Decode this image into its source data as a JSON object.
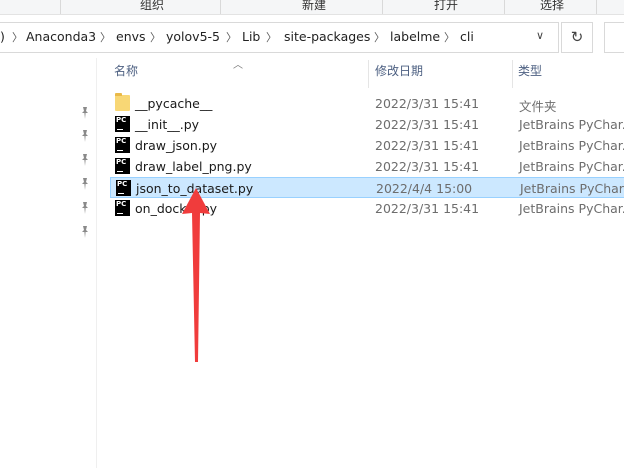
{
  "ribbon": {
    "labels": [
      "组织",
      "新建",
      "打开",
      "选择"
    ]
  },
  "address": {
    "crumbs": [
      "Anaconda3",
      "envs",
      "yolov5-5",
      "Lib",
      "site-packages",
      "labelme",
      "cli"
    ],
    "leading": ")"
  },
  "columns": {
    "name": "名称",
    "date": "修改日期",
    "type": "类型"
  },
  "files": [
    {
      "name": "__pycache__",
      "date": "2022/3/31 15:41",
      "type": "文件夹",
      "icon": "folder-icon"
    },
    {
      "name": "__init__.py",
      "date": "2022/3/31 15:41",
      "type": "JetBrains PyChar...",
      "icon": "pycharm-file-icon"
    },
    {
      "name": "draw_json.py",
      "date": "2022/3/31 15:41",
      "type": "JetBrains PyChar...",
      "icon": "pycharm-file-icon"
    },
    {
      "name": "draw_label_png.py",
      "date": "2022/3/31 15:41",
      "type": "JetBrains PyChar...",
      "icon": "pycharm-file-icon"
    },
    {
      "name": "json_to_dataset.py",
      "date": "2022/4/4 15:00",
      "type": "JetBrains PyChar...",
      "icon": "pycharm-file-icon",
      "selected": true
    },
    {
      "name": "on_docker.py",
      "date": "2022/3/31 15:41",
      "type": "JetBrains PyChar...",
      "icon": "pycharm-file-icon"
    }
  ],
  "icons": {
    "pc_text": "PC"
  },
  "colors": {
    "selection_bg": "#cce8ff",
    "selection_border": "#99d1ff",
    "annotation_arrow": "#f03c3c"
  }
}
